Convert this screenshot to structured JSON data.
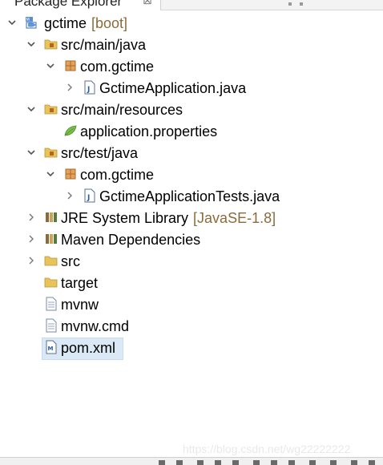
{
  "header": {
    "tab_title": "Package Explorer",
    "close_glyph": "⊠"
  },
  "tree": [
    {
      "label": "gctime",
      "decoration": "[boot]",
      "icon": "project-icon",
      "chevron": "expanded"
    },
    {
      "label": "src/main/java",
      "icon": "source-folder-icon",
      "chevron": "expanded"
    },
    {
      "label": "com.gctime",
      "icon": "package-icon",
      "chevron": "expanded"
    },
    {
      "label": "GctimeApplication.java",
      "icon": "java-file-icon",
      "chevron": "collapsed"
    },
    {
      "label": "src/main/resources",
      "icon": "source-folder-icon",
      "chevron": "expanded"
    },
    {
      "label": "application.properties",
      "icon": "properties-file-icon",
      "chevron": "none"
    },
    {
      "label": "src/test/java",
      "icon": "source-folder-icon",
      "chevron": "expanded"
    },
    {
      "label": "com.gctime",
      "icon": "package-icon",
      "chevron": "expanded"
    },
    {
      "label": "GctimeApplicationTests.java",
      "icon": "java-file-icon",
      "chevron": "collapsed"
    },
    {
      "label": "JRE System Library",
      "decoration": "[JavaSE-1.8]",
      "icon": "library-icon",
      "chevron": "collapsed"
    },
    {
      "label": "Maven Dependencies",
      "icon": "library-icon",
      "chevron": "collapsed"
    },
    {
      "label": "src",
      "icon": "folder-icon",
      "chevron": "collapsed"
    },
    {
      "label": "target",
      "icon": "folder-icon",
      "chevron": "none"
    },
    {
      "label": "mvnw",
      "icon": "text-file-icon",
      "chevron": "none"
    },
    {
      "label": "mvnw.cmd",
      "icon": "text-file-icon",
      "chevron": "none"
    },
    {
      "label": "pom.xml",
      "icon": "maven-pom-icon",
      "chevron": "none",
      "selected": true
    }
  ],
  "watermark": "https://blog.csdn.net/wg22222222",
  "colors": {
    "decoration": "#8b6b3a",
    "selection": "#dbe9f7",
    "folder": "#e7c35a",
    "package": "#b5651d",
    "java": "#2d5d9f"
  }
}
